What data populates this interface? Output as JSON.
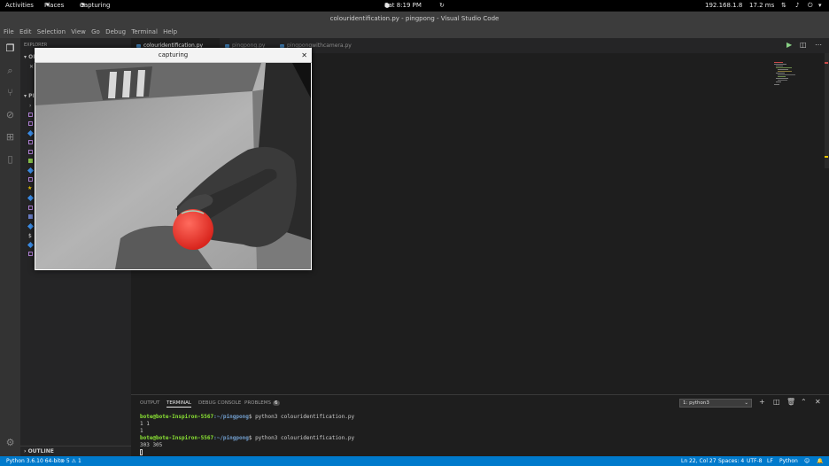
{
  "topbar": {
    "activities": "Activities",
    "places": "Places",
    "app": "Capturing",
    "clock": "Sat 8:19 PM",
    "ip": "192.168.1.8",
    "ping": "17.2 ms"
  },
  "window": {
    "title": "colouridentification.py - pingpong - Visual Studio Code"
  },
  "menu": [
    "File",
    "Edit",
    "Selection",
    "View",
    "Go",
    "Debug",
    "Terminal",
    "Help"
  ],
  "sidebar": {
    "section1_prefix": "OP",
    "section2_prefix": "PI",
    "close_marker": "✕",
    "outline": "OUTLINE"
  },
  "tabs": [
    {
      "label": "colouridentification.py",
      "active": true
    },
    {
      "label": "pingpong.py",
      "active": false
    },
    {
      "label": "pingpongwithcamera.py",
      "active": false
    }
  ],
  "panel": {
    "tabs": [
      "OUTPUT",
      "TERMINAL",
      "DEBUG CONSOLE",
      "PROBLEMS"
    ],
    "problems_count": "6",
    "terminal_select": "1: python3",
    "terminal": {
      "user1": "bote@bote-Inspiron-5567",
      "path1": ":~/pingpong",
      "cmd1": "$ python3 colouridentification.py",
      "out1": "1 1",
      "out2": "1",
      "user2": "bote@bote-Inspiron-5567",
      "path2": ":~/pingpong",
      "cmd2": "$ python3 colouridentification.py",
      "out3": "303 305"
    }
  },
  "status": {
    "python": "Python 3.6.10 64-bit",
    "problems": "⊗ 5 ⚠ 1",
    "cursor": "Ln 22, Col 27",
    "spaces": "Spaces: 4",
    "encoding": "UTF-8",
    "eol": "LF",
    "language": "Python"
  },
  "capture": {
    "title": "capturing",
    "close": "✕"
  },
  "colors": {
    "accent": "#007acc",
    "ball": "#e8312a"
  }
}
